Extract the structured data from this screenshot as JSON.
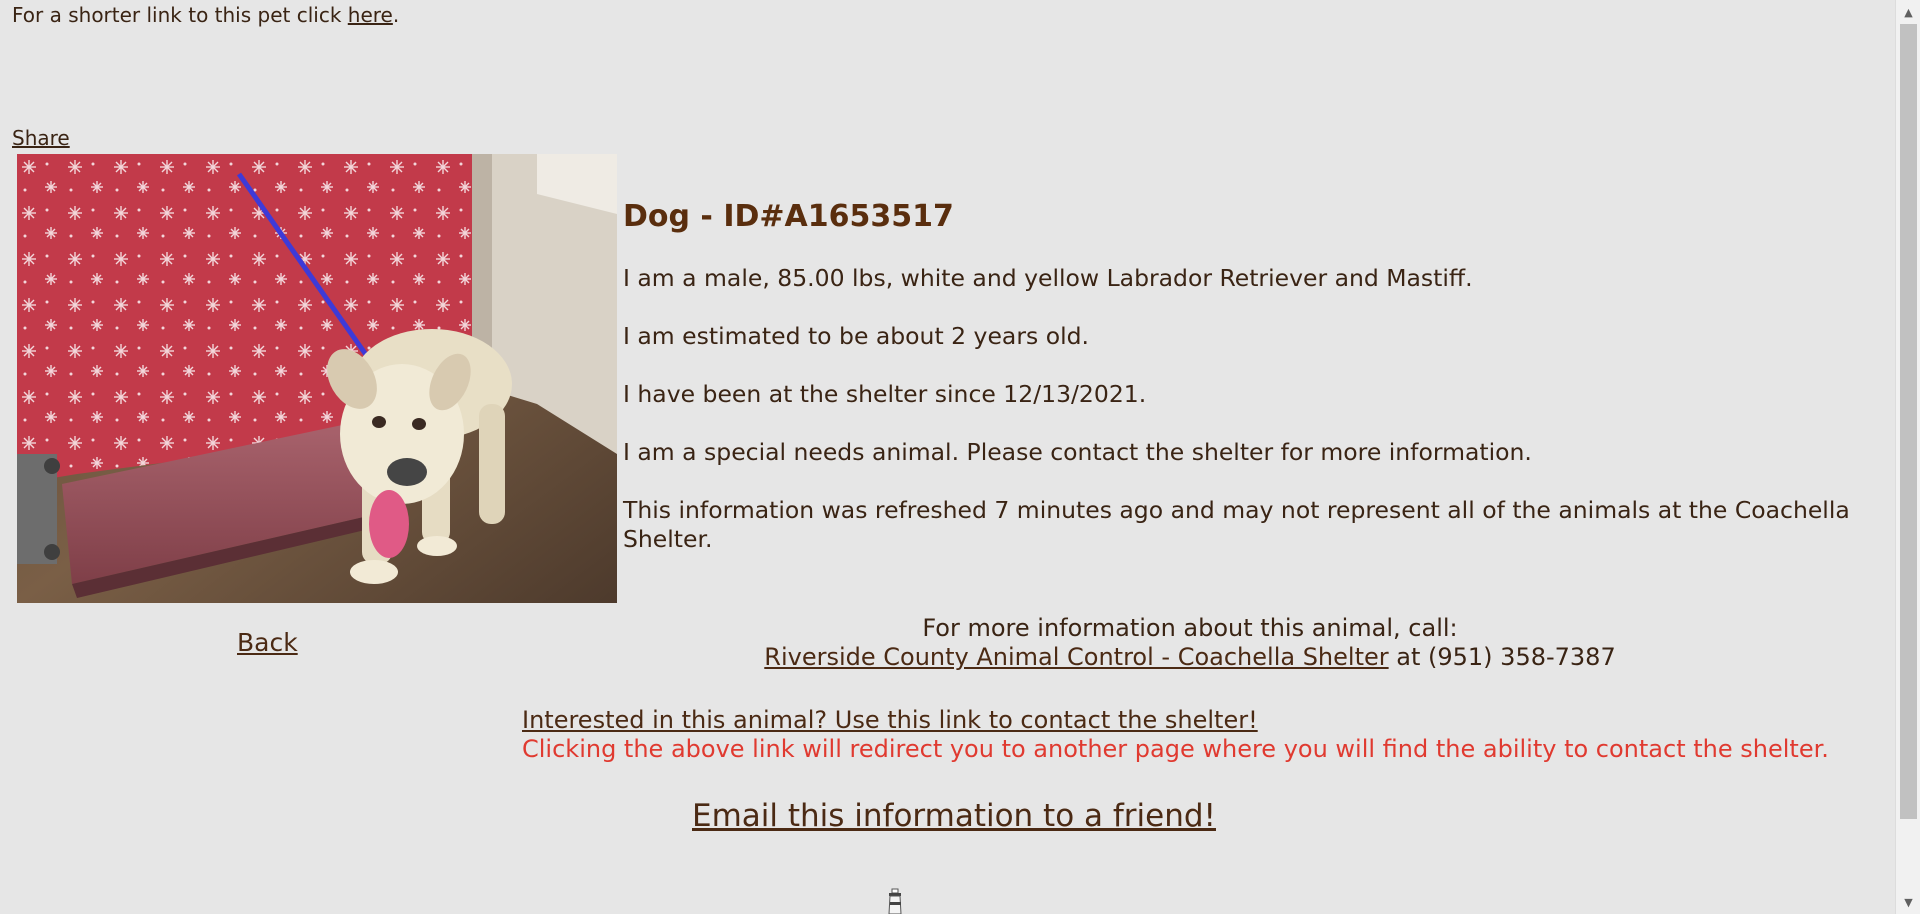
{
  "header": {
    "shortlink_prefix": "For a shorter link to this pet click",
    "shortlink_link": "here",
    "shortlink_suffix": ".",
    "share_label": "Share"
  },
  "animal": {
    "title": "Dog - ID#A1653517",
    "description": "I am a male, 85.00 lbs, white and yellow Labrador Retriever and Mastiff.",
    "age": "I am estimated to be about 2 years old.",
    "since": "I have been at the shelter since 12/13/2021.",
    "special_needs": "I am a special needs animal. Please contact the shelter for more information.",
    "refresh_note": "This information was refreshed 7 minutes ago and may not represent all of the animals at the Coachella Shelter."
  },
  "nav": {
    "back_label": "Back"
  },
  "contact": {
    "call_prompt": "For more information about this animal, call:",
    "shelter_name": "Riverside County Animal Control - Coachella Shelter",
    "phone_text": "at (951) 358-7387"
  },
  "interest": {
    "link_label": "Interested in this animal? Use this link to contact the shelter!",
    "redirect_note": "Clicking the above link will redirect you to another page where you will find the ability to contact the shelter."
  },
  "email": {
    "label": "Email this information to a friend!"
  },
  "colors": {
    "background": "#e6e6e6",
    "text": "#3a2414",
    "title": "#5a2e0e",
    "warning": "#e03a30"
  },
  "icons": {
    "scroll_up": "▲",
    "scroll_down": "▼"
  }
}
